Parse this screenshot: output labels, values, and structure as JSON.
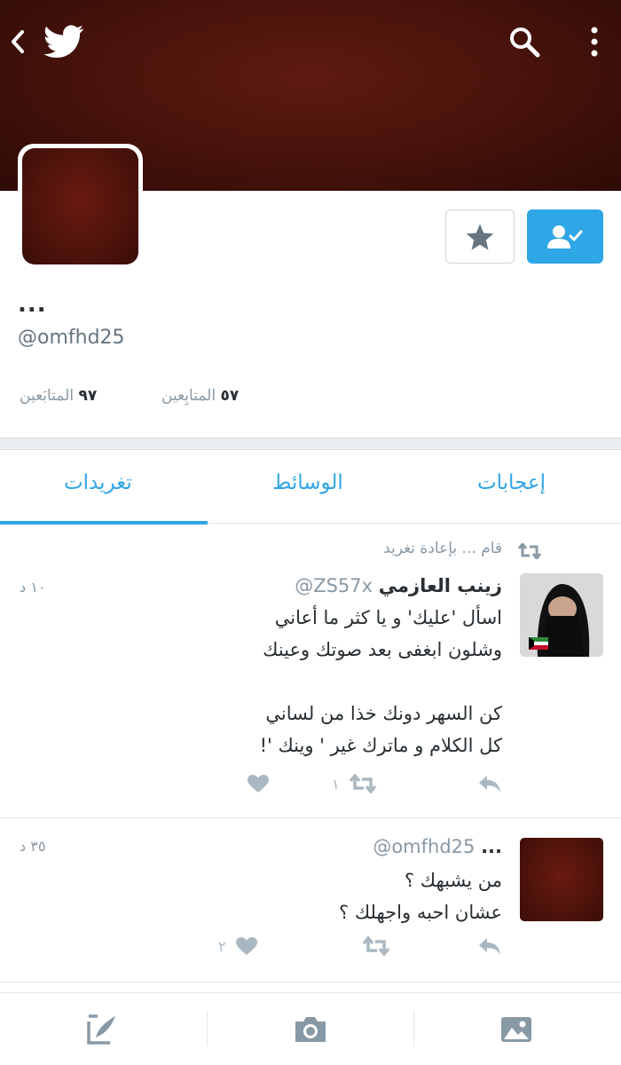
{
  "profile": {
    "display_name": "...",
    "handle": "@omfhd25",
    "followers_count": "٩٧",
    "followers_label": "المتابَعين",
    "following_count": "٥٧",
    "following_label": "المتابِعين"
  },
  "tabs": [
    {
      "label": "تغريدات",
      "active": true
    },
    {
      "label": "الوسائط",
      "active": false
    },
    {
      "label": "إعجابات",
      "active": false
    }
  ],
  "tweets": [
    {
      "retweet_context": "قام ... بإعادة تغريد",
      "author_name": "زينب العازمي",
      "author_handle": "@ZS57x",
      "time": "١٠ د",
      "lines": [
        "اسأل 'عليك' و يا كثر ما أعاني",
        "وشلون ابغفى بعد صوتك وعينك",
        "",
        "كن السهر دونك خذا من لساني",
        "كل الكلام و ماترك غير ' وينك '!"
      ],
      "retweet_count": "١",
      "like_count": ""
    },
    {
      "author_name": "...",
      "author_handle": "@omfhd25",
      "time": "٣٥ د",
      "lines": [
        "من يشبهك ؟",
        "عشان احبه واجهلك ؟"
      ],
      "retweet_count": "",
      "like_count": "٢"
    }
  ],
  "icons": {
    "back": "chevron-left-icon",
    "logo": "twitter-bird-icon",
    "search": "search-icon",
    "more": "more-vertical-icon",
    "star": "star-icon",
    "follow": "following-check-icon",
    "reply": "reply-icon",
    "retweet": "retweet-icon",
    "like": "heart-icon",
    "compose": "compose-icon",
    "camera": "camera-icon",
    "photo": "photo-icon"
  },
  "colors": {
    "accent": "#2fa6e6",
    "header_bg": "#4a140c",
    "muted": "#8899a6"
  }
}
